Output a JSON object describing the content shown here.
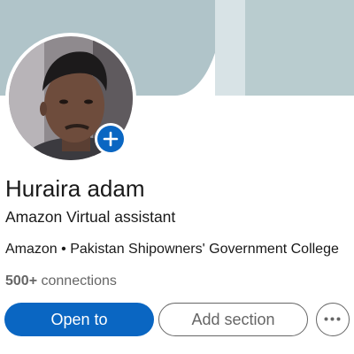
{
  "profile": {
    "name": "Huraira adam",
    "headline": "Amazon Virtual assistant",
    "company": "Amazon",
    "separator": "•",
    "education": "Pakistan Shipowners' Government College",
    "connections_count": "500+",
    "connections_label": "connections"
  },
  "actions": {
    "primary_label": "Open to",
    "secondary_label": "Add section",
    "more_icon": "more-horizontal-icon"
  },
  "avatar": {
    "add_icon": "plus-icon"
  },
  "colors": {
    "brand": "#0a66c2",
    "text": "#191919",
    "muted": "#666666",
    "cover": "#b0c4c9"
  }
}
